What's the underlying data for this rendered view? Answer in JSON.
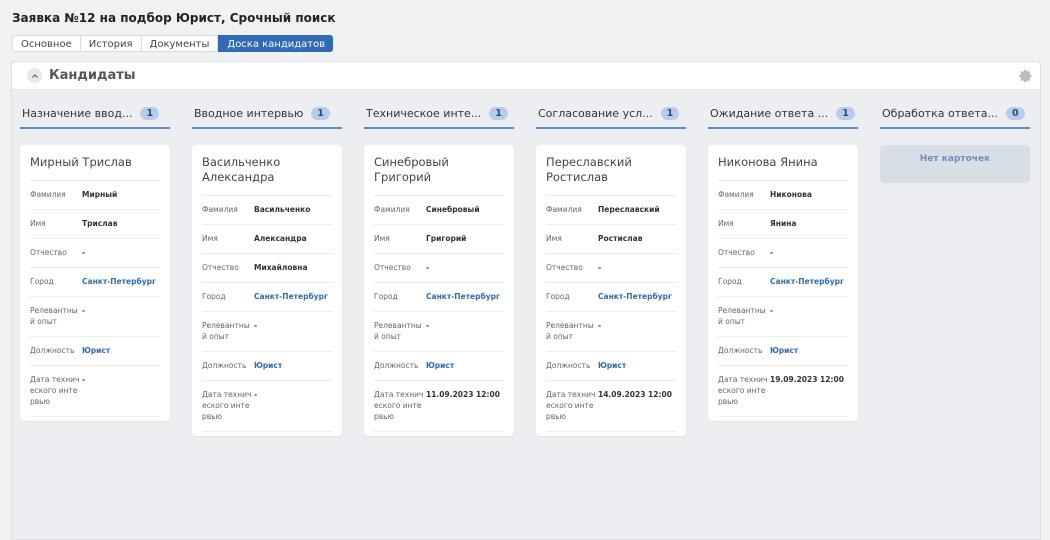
{
  "page_title": "Заявка №12 на подбор Юрист, Срочный поиск",
  "tabs": [
    {
      "label": "Основное"
    },
    {
      "label": "История"
    },
    {
      "label": "Документы"
    },
    {
      "label": "Доска кандидатов"
    }
  ],
  "panel": {
    "title": "Кандидаты"
  },
  "columns": [
    {
      "title": "Назначение ввод...",
      "count": "1",
      "card": {
        "name": "Мирный Трислав",
        "fields": [
          {
            "label": "Фамилия",
            "value": "Мирный"
          },
          {
            "label": "Имя",
            "value": "Трислав"
          },
          {
            "label": "Отчество",
            "value": "-"
          },
          {
            "label": "Город",
            "value": "Санкт-Петербург"
          },
          {
            "label": "Релевантный опыт",
            "value": "-"
          },
          {
            "label": "Должность",
            "value": "Юрист"
          },
          {
            "label": "Дата технического интервью",
            "value": "-"
          }
        ]
      }
    },
    {
      "title": "Вводное интервью",
      "count": "1",
      "card": {
        "name": "Васильченко Александра",
        "fields": [
          {
            "label": "Фамилия",
            "value": "Васильченко"
          },
          {
            "label": "Имя",
            "value": "Александра"
          },
          {
            "label": "Отчество",
            "value": "Михайловна"
          },
          {
            "label": "Город",
            "value": "Санкт-Петербург"
          },
          {
            "label": "Релевантный опыт",
            "value": "-"
          },
          {
            "label": "Должность",
            "value": "Юрист"
          },
          {
            "label": "Дата технического интервью",
            "value": "-"
          }
        ]
      }
    },
    {
      "title": "Техническое инте...",
      "count": "1",
      "card": {
        "name": "Синебровый Григорий",
        "fields": [
          {
            "label": "Фамилия",
            "value": "Синебровый"
          },
          {
            "label": "Имя",
            "value": "Григорий"
          },
          {
            "label": "Отчество",
            "value": "-"
          },
          {
            "label": "Город",
            "value": "Санкт-Петербург"
          },
          {
            "label": "Релевантный опыт",
            "value": "-"
          },
          {
            "label": "Должность",
            "value": "Юрист"
          },
          {
            "label": "Дата технического интервью",
            "value": "11.09.2023 12:00"
          }
        ]
      }
    },
    {
      "title": "Согласование усл...",
      "count": "1",
      "card": {
        "name": "Переславский Ростислав",
        "fields": [
          {
            "label": "Фамилия",
            "value": "Переславский"
          },
          {
            "label": "Имя",
            "value": "Ростислав"
          },
          {
            "label": "Отчество",
            "value": "-"
          },
          {
            "label": "Город",
            "value": "Санкт-Петербург"
          },
          {
            "label": "Релевантный опыт",
            "value": "-"
          },
          {
            "label": "Должность",
            "value": "Юрист"
          },
          {
            "label": "Дата технического интервью",
            "value": "14.09.2023 12:00"
          }
        ]
      }
    },
    {
      "title": "Ожидание ответа ...",
      "count": "1",
      "card": {
        "name": "Никонова Янина",
        "fields": [
          {
            "label": "Фамилия",
            "value": "Никонова"
          },
          {
            "label": "Имя",
            "value": "Янина"
          },
          {
            "label": "Отчество",
            "value": "-"
          },
          {
            "label": "Город",
            "value": "Санкт-Петербург"
          },
          {
            "label": "Релевантный опыт",
            "value": "-"
          },
          {
            "label": "Должность",
            "value": "Юрист"
          },
          {
            "label": "Дата технического интервью",
            "value": "19.09.2023 12:00"
          }
        ]
      }
    },
    {
      "title": "Обработка ответа...",
      "count": "0",
      "empty_text": "Нет карточек"
    }
  ],
  "icons": {
    "collapse": "chevron-up-icon",
    "settings": "gear-icon"
  },
  "colors": {
    "accent": "#2f6ab3",
    "link": "#2f6ab3",
    "column_underline": "#5b8fd1",
    "badge_bg": "#b9cde8"
  }
}
